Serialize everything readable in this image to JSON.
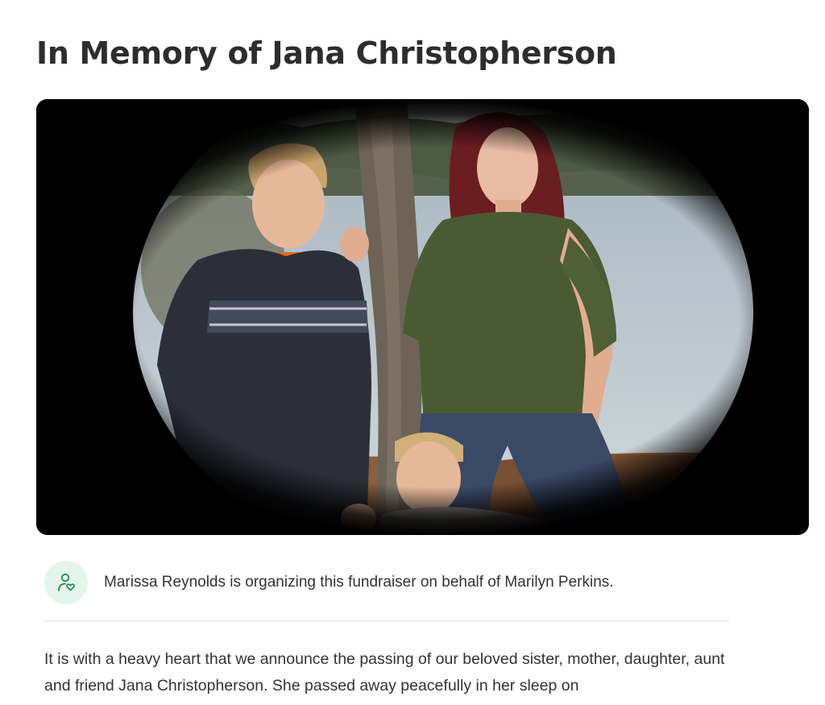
{
  "page": {
    "title": "In Memory of Jana Christopherson"
  },
  "hero": {
    "description": "Family photo of a woman and two boys by a lake",
    "vignette_color": "#000000"
  },
  "organizer": {
    "icon": "person-heart-icon",
    "text": "Marissa Reynolds is organizing this fundraiser on behalf of Marilyn Perkins.",
    "accent_color": "#1a8a4b",
    "icon_background": "#e5f5ec"
  },
  "story": {
    "text": "It is with a heavy heart that we announce the passing of our beloved sister, mother, daughter, aunt and friend Jana Christopherson. She passed away peacefully in her sleep on"
  }
}
